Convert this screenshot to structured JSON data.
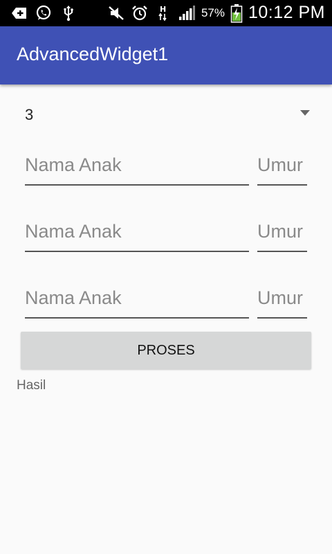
{
  "status_bar": {
    "icons_left": [
      "add-box-icon",
      "whatsapp-icon",
      "usb-icon"
    ],
    "icons_right": [
      "mute-icon",
      "alarm-icon",
      "hsdpa-icon",
      "signal-icon"
    ],
    "battery_percent": "57%",
    "time": "10:12 PM"
  },
  "app_bar": {
    "title": "AdvancedWidget1"
  },
  "spinner": {
    "selected": "3"
  },
  "rows": [
    {
      "name_placeholder": "Nama Anak",
      "age_placeholder": "Umur"
    },
    {
      "name_placeholder": "Nama Anak",
      "age_placeholder": "Umur"
    },
    {
      "name_placeholder": "Nama Anak",
      "age_placeholder": "Umur"
    }
  ],
  "button": {
    "label": "PROSES"
  },
  "result": {
    "text": "Hasil"
  },
  "colors": {
    "primary": "#3f51b5",
    "status_bar": "#000000",
    "button": "#d6d7d7"
  }
}
